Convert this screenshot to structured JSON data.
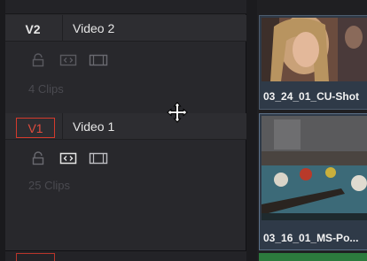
{
  "tracks": [
    {
      "id": "V2",
      "name": "Video 2",
      "clip_count": "4 Clips",
      "selected": false
    },
    {
      "id": "V1",
      "name": "Video 1",
      "clip_count": "25 Clips",
      "selected": true
    }
  ],
  "clips": [
    {
      "label": "03_24_01_CU-Shot"
    },
    {
      "label": "03_16_01_MS-Po..."
    }
  ],
  "colors": {
    "selected_track": "#d43a2c",
    "clip_border": "#4d5c6d",
    "audio_bar": "#2c7a3d"
  },
  "icons": {
    "lock": "lock-icon",
    "auto_select": "auto-select-icon",
    "video_toggle": "filmstrip-icon",
    "cursor": "move-cursor-icon"
  }
}
